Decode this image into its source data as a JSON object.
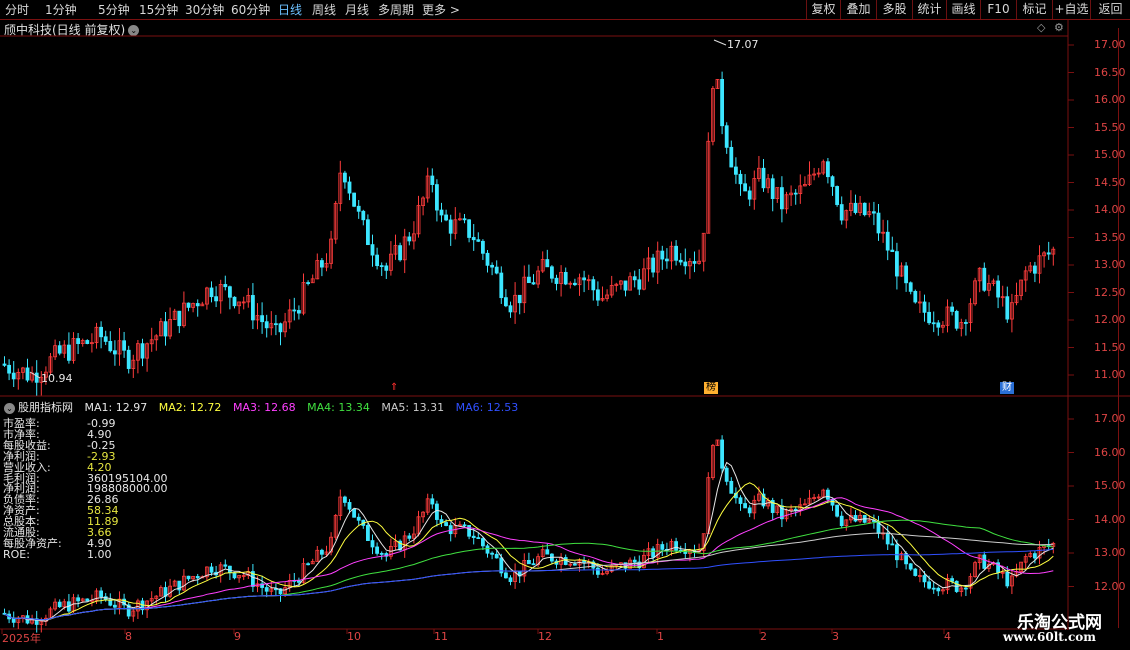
{
  "toolbar": {
    "periods": [
      "分时",
      "1分钟",
      "5分钟",
      "15分钟",
      "30分钟",
      "60分钟",
      "日线",
      "周线",
      "月线",
      "多周期",
      "更多 >"
    ],
    "active_period": "日线",
    "right_buttons": [
      "复权",
      "叠加",
      "多股",
      "统计",
      "画线",
      "F10",
      "标记",
      "+自选",
      "返回"
    ]
  },
  "stock_title": "颀中科技(日线 前复权)",
  "icons": {
    "title_toggle": "chevron-down-icon",
    "diamond": "diamond-icon",
    "settings": "gear-icon"
  },
  "price_axis": [
    "17.00",
    "16.50",
    "16.00",
    "15.50",
    "15.00",
    "14.50",
    "14.00",
    "13.50",
    "13.00",
    "12.50",
    "12.00",
    "11.50",
    "11.00"
  ],
  "indicator_axis": [
    "17.00",
    "16.00",
    "15.00",
    "14.00",
    "13.00",
    "12.00"
  ],
  "annotations": {
    "high": "17.07",
    "low": "10.94"
  },
  "event_markers": [
    {
      "label": "⇑",
      "color": "#ff3030"
    },
    {
      "label": "榜",
      "color": "#ffb030"
    },
    {
      "label": "财",
      "color": "#3aa0ff"
    }
  ],
  "indicator": {
    "name": "股朋指标网",
    "ma": [
      {
        "label": "MA1: 12.97",
        "color": "#e6e6e6"
      },
      {
        "label": "MA2: 12.72",
        "color": "#ffff40"
      },
      {
        "label": "MA3: 12.68",
        "color": "#ff40ff"
      },
      {
        "label": "MA4: 13.34",
        "color": "#40e040"
      },
      {
        "label": "MA5: 13.31",
        "color": "#cccccc"
      },
      {
        "label": "MA6: 12.53",
        "color": "#3050ff"
      }
    ]
  },
  "financials": [
    {
      "label": "市盈率:",
      "value": "-0.99",
      "color": "#e6e6e6"
    },
    {
      "label": "市净率:",
      "value": "4.90",
      "color": "#e6e6e6"
    },
    {
      "label": "每股收益:",
      "value": "-0.25",
      "color": "#e6e6e6"
    },
    {
      "label": "净利润:",
      "value": "-2.93",
      "color": "#e6e640"
    },
    {
      "label": "营业收入:",
      "value": "4.20",
      "color": "#e6e640"
    },
    {
      "label": "毛利润:",
      "value": "360195104.00",
      "color": "#e6e6e6"
    },
    {
      "label": "净利润:",
      "value": "198808000.00",
      "color": "#e6e6e6"
    },
    {
      "label": "负债率:",
      "value": "26.86",
      "color": "#e6e6e6"
    },
    {
      "label": "净资产:",
      "value": "58.34",
      "color": "#e6e640"
    },
    {
      "label": "总股本:",
      "value": "11.89",
      "color": "#e6e640"
    },
    {
      "label": "流通股:",
      "value": "3.66",
      "color": "#e6e640"
    },
    {
      "label": "每股净资产:",
      "value": "4.90",
      "color": "#e6e6e6"
    },
    {
      "label": "ROE:",
      "value": "1.00",
      "color": "#e6e6e6"
    }
  ],
  "x_axis": [
    "2025年",
    "8",
    "9",
    "10",
    "11",
    "12",
    "1",
    "2",
    "3",
    "4"
  ],
  "watermark": {
    "title": "乐淘公式网",
    "url": "www.60lt.com"
  },
  "colors": {
    "up": "#ff3c3c",
    "down": "#3ce6ff",
    "grid": "#7a1010",
    "axis_text": "#dd4444"
  }
}
